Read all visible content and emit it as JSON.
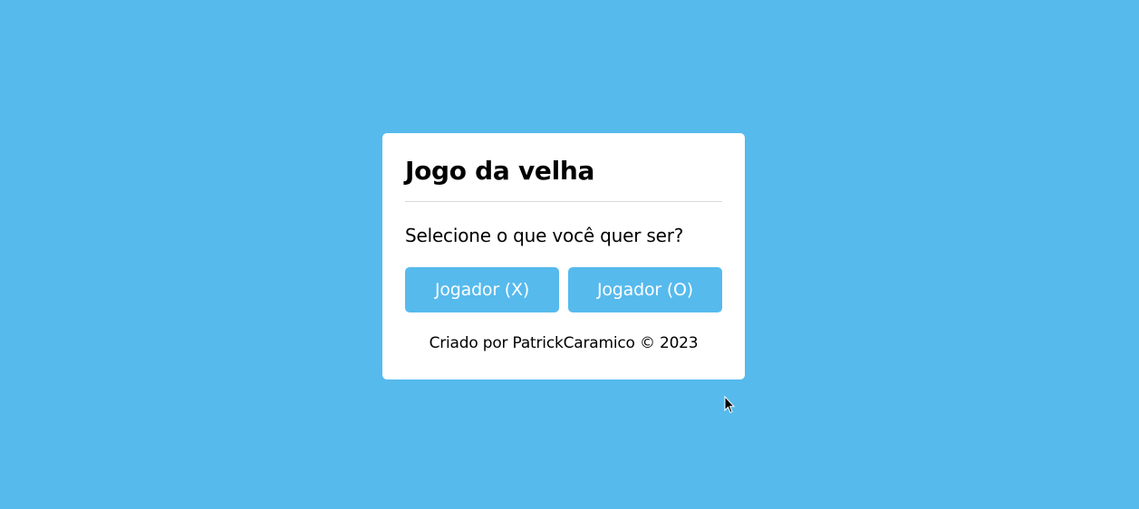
{
  "app": {
    "title": "Jogo da velha",
    "prompt": "Selecione o que você quer ser?",
    "buttons": {
      "player_x": "Jogador (X)",
      "player_o": "Jogador (O)"
    },
    "footer": "Criado por PatrickCaramico © 2023"
  },
  "colors": {
    "background": "#56baed",
    "card": "#ffffff",
    "button": "#56baed",
    "button_text": "#ffffff",
    "text": "#000000"
  },
  "icons": {
    "cursor": "mouse-pointer-icon"
  }
}
